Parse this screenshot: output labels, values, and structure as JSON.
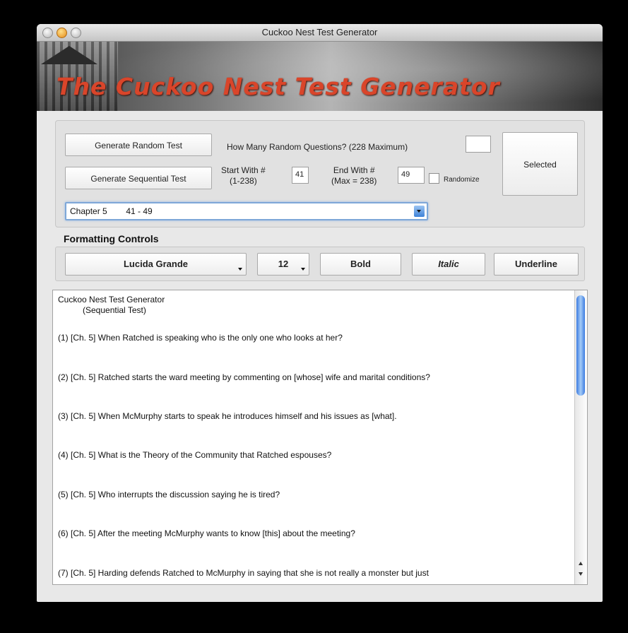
{
  "window": {
    "title": "Cuckoo Nest Test Generator"
  },
  "banner": {
    "title": "The Cuckoo Nest Test Generator"
  },
  "controls": {
    "generate_random_label": "Generate Random Test",
    "generate_sequential_label": "Generate Sequential Test",
    "how_many_label": "How Many Random Questions? (228 Maximum)",
    "how_many_value": "",
    "start_label": "Start With #\n(1-238)",
    "start_value": "41",
    "end_label": "End With #\n(Max = 238)",
    "end_value": "49",
    "randomize_label": "Randomize",
    "randomize_checked": false,
    "selected_label": "Selected",
    "chapter_select": "Chapter 5        41 - 49"
  },
  "formatting": {
    "title": "Formatting Controls",
    "font": "Lucida Grande",
    "size": "12",
    "bold_label": "Bold",
    "italic_label": "Italic",
    "underline_label": "Underline"
  },
  "document": {
    "title": "Cuckoo Nest Test Generator",
    "subtitle": "(Sequential Test)",
    "questions": [
      "(1)  [Ch. 5] When Ratched is speaking who is the only one who looks at her?",
      "(2)  [Ch. 5] Ratched starts the ward meeting by commenting on [whose] wife and marital conditions?",
      "(3)  [Ch. 5] When McMurphy starts to speak he introduces himself and his issues as [what].",
      "(4)  [Ch. 5] What is the Theory of the Community that Ratched espouses?",
      "(5)  [Ch. 5] Who interrupts the discussion saying he is tired?",
      "(6)  [Ch. 5] After the meeting McMurphy wants to know [this] about the meeting?",
      "(7)  [Ch. 5] Harding defends Ratched to McMurphy in saying that she is not really a monster but just"
    ]
  }
}
